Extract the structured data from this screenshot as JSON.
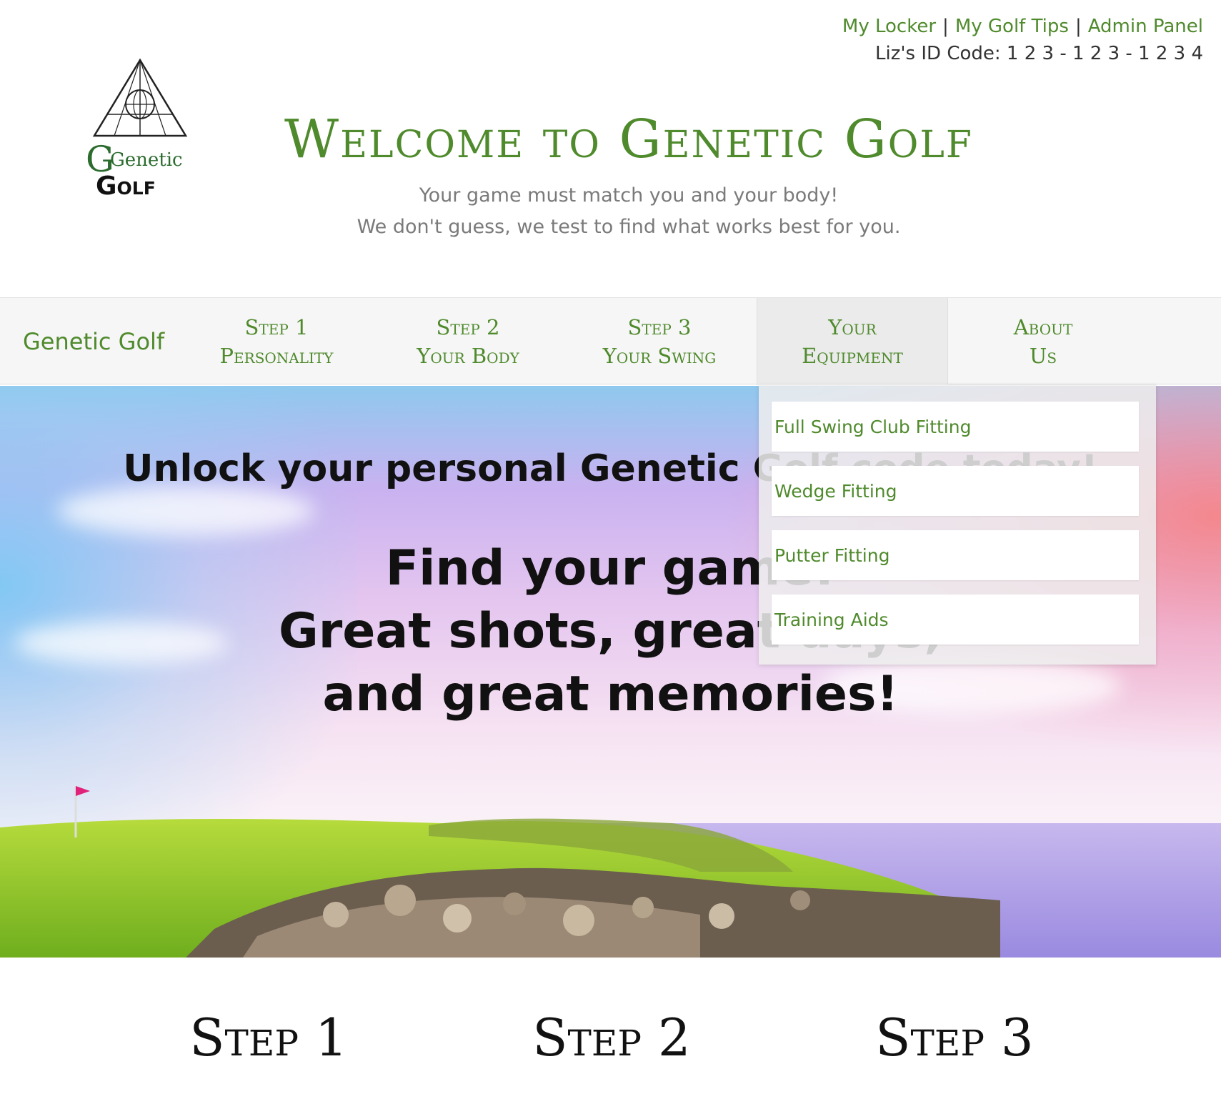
{
  "header": {
    "links": [
      "My Locker",
      "My Golf Tips",
      "Admin Panel"
    ],
    "link_separator": "|",
    "id_code": "Liz's ID Code: 1 2 3 - 1 2 3 - 1 2 3 4",
    "title": "Welcome to Genetic Golf",
    "tagline_1": "Your game must match you and your body!",
    "tagline_2": "We don't guess, we test to find what works best for you.",
    "logo": {
      "word_1": "Genetic",
      "word_2": "Golf",
      "icon": "triangle-globe-logo"
    }
  },
  "nav": {
    "brand": "Genetic Golf",
    "items": [
      {
        "line1": "Step 1",
        "line2": "Personality"
      },
      {
        "line1": "Step 2",
        "line2": "Your Body"
      },
      {
        "line1": "Step 3",
        "line2": "Your Swing"
      },
      {
        "line1": "Your",
        "line2": "Equipment",
        "active": true
      },
      {
        "line1": "About",
        "line2": "Us"
      }
    ]
  },
  "dropdown": {
    "items": [
      "Full Swing Club Fitting",
      "Wedge Fitting",
      "Putter Fitting",
      "Training Aids"
    ]
  },
  "hero": {
    "line1": "Unlock your personal Genetic Golf code today!",
    "line2": "Find your game!",
    "line3": "Great shots, great days,",
    "line4": "and great memories!"
  },
  "steps": [
    "Step 1",
    "Step 2",
    "Step 3"
  ],
  "colors": {
    "accent": "#4f8a2c",
    "text": "#111111",
    "muted": "#7a7a7a"
  }
}
